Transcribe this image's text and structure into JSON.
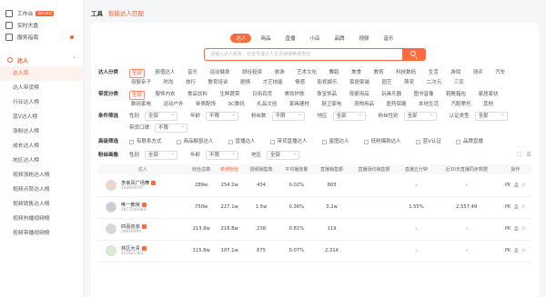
{
  "sidebar": {
    "top_items": [
      {
        "label": "工作台",
        "badge": "限时体验"
      },
      {
        "label": "实时大盘"
      },
      {
        "label": "服务指南"
      }
    ],
    "group": {
      "label": "达人"
    },
    "items": [
      {
        "label": "达人库",
        "active": true
      },
      {
        "label": "达人带货榜"
      },
      {
        "label": "行业达人榜"
      },
      {
        "label": "蓝V达人榜"
      },
      {
        "label": "涨粉达人榜"
      },
      {
        "label": "成长达人榜"
      },
      {
        "label": "地区达人榜"
      },
      {
        "label": "视频涨粉达人榜"
      },
      {
        "label": "视频点赞达人榜"
      },
      {
        "label": "视频销售达人榜"
      },
      {
        "label": "视频热播视频榜"
      },
      {
        "label": "视频带播视频榜"
      }
    ]
  },
  "breadcrumb": {
    "root": "工具",
    "current": "智能达人匹配"
  },
  "tabs": [
    "达人",
    "商品",
    "直播",
    "小店",
    "品牌",
    "视频",
    "音乐"
  ],
  "search": {
    "placeholder": "请输入达人昵称、抖音号或达人主页链接精准查找"
  },
  "filters": {
    "category": {
      "label": "达人分类",
      "values": [
        "全部",
        "颜值达人",
        "音乐",
        "运动健身",
        "财经投资",
        "旅游",
        "艺术文化",
        "舞蹈",
        "美食",
        "教育",
        "科技数码",
        "生活",
        "游戏",
        "测评",
        "汽车",
        "母婴亲子",
        "时尚",
        "旅行",
        "教育培训",
        "剧情",
        "才艺技能",
        "情感",
        "影视娱乐",
        "家居家装",
        "园艺",
        "萌宠",
        "二次元",
        "三农"
      ]
    },
    "goods": {
      "label": "带货分类",
      "values": [
        "全部",
        "服饰内衣",
        "食品饮料",
        "生鲜蔬菜",
        "日用百货",
        "美妆护肤",
        "珠宝饰品",
        "母婴用品",
        "玩具乐器",
        "图书音像",
        "鞋靴箱包",
        "家居家纺",
        "数码家电",
        "运动户外",
        "钟表配饰",
        "3C数码",
        "礼品文创",
        "家具建材",
        "厨卫家电",
        "宠物用品",
        "医药保健",
        "本地生活",
        "汽配摩托",
        "其他"
      ]
    },
    "conditions": {
      "label": "条件筛选",
      "selects": [
        {
          "label": "性别",
          "value": "全部"
        },
        {
          "label": "年龄",
          "value": "不限"
        },
        {
          "label": "粉丝数",
          "value": "不限"
        },
        {
          "label": "地区",
          "value": "全部"
        },
        {
          "label": "粉丝性别",
          "value": "全部"
        },
        {
          "label": "认证类型",
          "value": "全部"
        },
        {
          "label": "带货口碑",
          "value": "不限"
        }
      ]
    },
    "advanced": {
      "label": "高级筛选",
      "checks": [
        "有联系方式",
        "商品橱窗达人",
        "直播达人",
        "带货直播达人",
        "星图达人",
        "低粉爆款达人",
        "蓝V认证",
        "品牌直播"
      ]
    },
    "fans": {
      "label": "粉丝画像",
      "selects": [
        {
          "label": "性别",
          "value": "全部"
        },
        {
          "label": "年龄",
          "value": "不限"
        },
        {
          "label": "地区",
          "value": "全部"
        }
      ]
    }
  },
  "table": {
    "headers": [
      "达人",
      "粉丝总数",
      "新增粉丝",
      "视频销售数",
      "平均播放量",
      "直播销售额",
      "直播场均销售额",
      "直播五分钟",
      "近30天直播同步数据",
      "操作"
    ],
    "rows": [
      {
        "name": "李孝凤广场舞",
        "id": "104059797",
        "fans": "289w",
        "new_fans": "254.2w",
        "videos": "434",
        "avg_play": "0.02%",
        "live_sales": "803",
        "live_avg": "",
        "five_min": "-",
        "recent": "-"
      },
      {
        "name": "唯一教授",
        "id": "1877544343",
        "fans": "750w",
        "new_fans": "227.1w",
        "videos": "1.5w",
        "avg_play": "0.36%",
        "live_sales": "3.2w",
        "live_avg": "",
        "five_min": "1.55%",
        "recent": "2,557.49"
      },
      {
        "name": "四喜叔叔",
        "id": "26619599",
        "fans": "213.8w",
        "new_fans": "216.8w",
        "videos": "238",
        "avg_play": "0.81%",
        "live_sales": "119",
        "live_avg": "",
        "five_min": "-",
        "recent": "-"
      },
      {
        "name": "林区大青",
        "id": "121621383",
        "fans": "115.8w",
        "new_fans": "107.1w",
        "videos": "675",
        "avg_play": "0.07%",
        "live_sales": "2,314",
        "live_avg": "",
        "five_min": "-",
        "recent": "-"
      }
    ],
    "op_label": "PK"
  },
  "colors": {
    "accent": "#ff6b3d"
  }
}
